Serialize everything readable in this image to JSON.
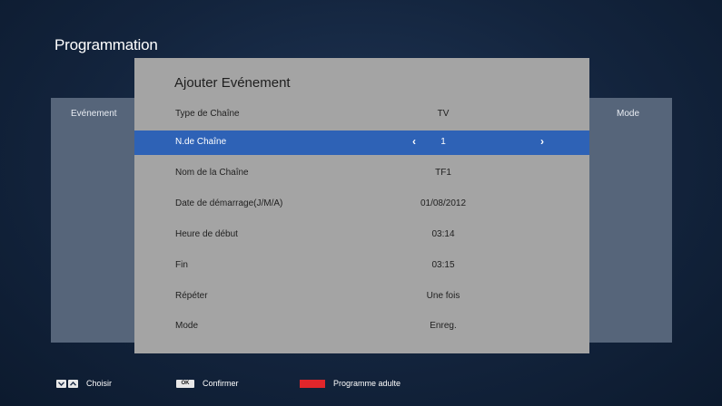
{
  "page_title": "Programmation",
  "background_table": {
    "col_event": "Evénement",
    "col_mode": "Mode"
  },
  "dialog": {
    "title": "Ajouter Evénement",
    "rows": [
      {
        "label": "Type de Chaîne",
        "value": "TV"
      },
      {
        "label": "N.de Chaîne",
        "value": "1",
        "selected": true
      },
      {
        "label": "Nom de la Chaîne",
        "value": "TF1"
      },
      {
        "label": "Date de démarrage(J/M/A)",
        "value": "01/08/2012"
      },
      {
        "label": "Heure de début",
        "value": "03:14"
      },
      {
        "label": "Fin",
        "value": "03:15"
      },
      {
        "label": "Répéter",
        "value": "Une fois"
      },
      {
        "label": "Mode",
        "value": "Enreg."
      }
    ],
    "arrow_left": "‹",
    "arrow_right": "›"
  },
  "legend": {
    "choose_label": "Choisir",
    "ok_key": "OK",
    "confirm_label": "Confirmer",
    "adult_label": "Programme adulte"
  },
  "colors": {
    "highlight": "#2e62b6",
    "dialog_bg": "#a4a4a4",
    "panel_bg": "#56657a",
    "red_key": "#e0262b"
  }
}
